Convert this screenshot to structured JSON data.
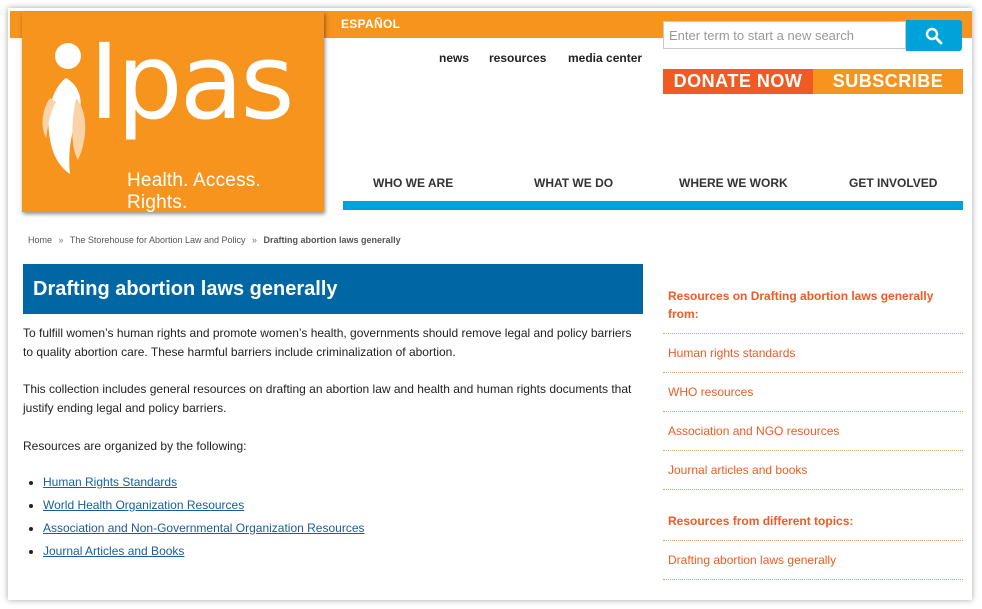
{
  "header": {
    "espanol_label": "ESPAÑOL",
    "logo": {
      "wordmark": "Ipas",
      "tagline": "Health. Access. Rights."
    },
    "utility_nav": [
      "news",
      "resources",
      "media center"
    ],
    "search": {
      "placeholder": "Enter term to start a new search",
      "button_icon": "search-icon"
    },
    "donate_label": "DONATE NOW",
    "subscribe_label": "SUBSCRIBE",
    "main_nav": [
      "WHO WE ARE",
      "WHAT WE DO",
      "WHERE WE WORK",
      "GET INVOLVED"
    ]
  },
  "breadcrumb": {
    "items": [
      "Home",
      "The Storehouse for Abortion Law and Policy",
      "Drafting abortion laws generally"
    ]
  },
  "main": {
    "title": "Drafting abortion laws generally",
    "paragraphs": [
      "To fulfill women’s human rights and promote women’s health, governments should remove legal and policy barriers to quality abortion care. These harmful barriers include criminalization of abortion.",
      "This collection includes general resources on drafting an abortion law and health and human rights documents that justify ending legal and policy barriers.",
      "Resources are organized by the following:"
    ],
    "resource_links": [
      "Human Rights Standards",
      "World Health Organization Resources",
      "Association and Non-Governmental Organization Resources",
      "Journal Articles and Books"
    ]
  },
  "sidebar": {
    "heading1": "Resources on Drafting abortion laws generally from:",
    "links1": [
      "Human rights standards",
      "WHO resources",
      "Association and NGO resources",
      "Journal articles and books"
    ],
    "heading2": "Resources from different topics:",
    "links2": [
      "Drafting abortion laws generally"
    ]
  },
  "colors": {
    "orange": "#f7941d",
    "dark_orange": "#f15a22",
    "blue": "#0067a5",
    "cyan": "#00a3d9"
  }
}
